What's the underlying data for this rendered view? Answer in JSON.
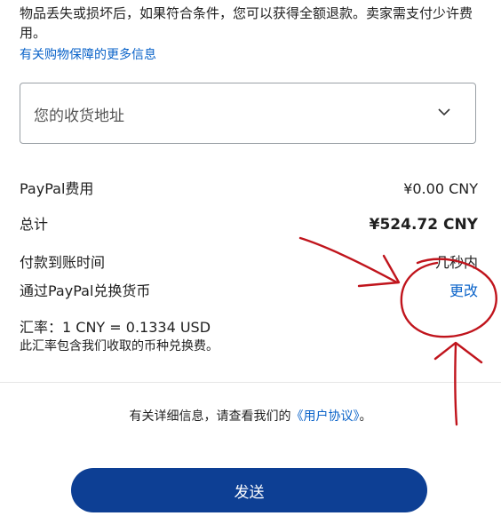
{
  "protection": {
    "text": "物品丢失或损坏后，如果符合条件，您可以获得全额退款。卖家需支付少许费用。",
    "link": "有关购物保障的更多信息"
  },
  "address": {
    "placeholder": "您的收货地址",
    "icon": "chevron-down-icon"
  },
  "summary": {
    "fee_label": "PayPal费用",
    "fee_value": "¥0.00 CNY",
    "total_label": "总计",
    "total_value": "¥524.72 CNY",
    "arrival_label": "付款到账时间",
    "arrival_value": "几秒内",
    "convert_label": "通过PayPal兑换货币",
    "convert_action": "更改"
  },
  "rate": {
    "line": "汇率：1 CNY = 0.1334 USD",
    "note": "此汇率包含我们收取的币种兑换费。"
  },
  "agreement": {
    "prefix": "有关详细信息，请查看我们的",
    "link": "《用户协议》",
    "suffix": "。"
  },
  "send_button": "发送",
  "colors": {
    "link": "#0a63c9",
    "button": "#0d3f94",
    "annotation": "#c0141c"
  }
}
